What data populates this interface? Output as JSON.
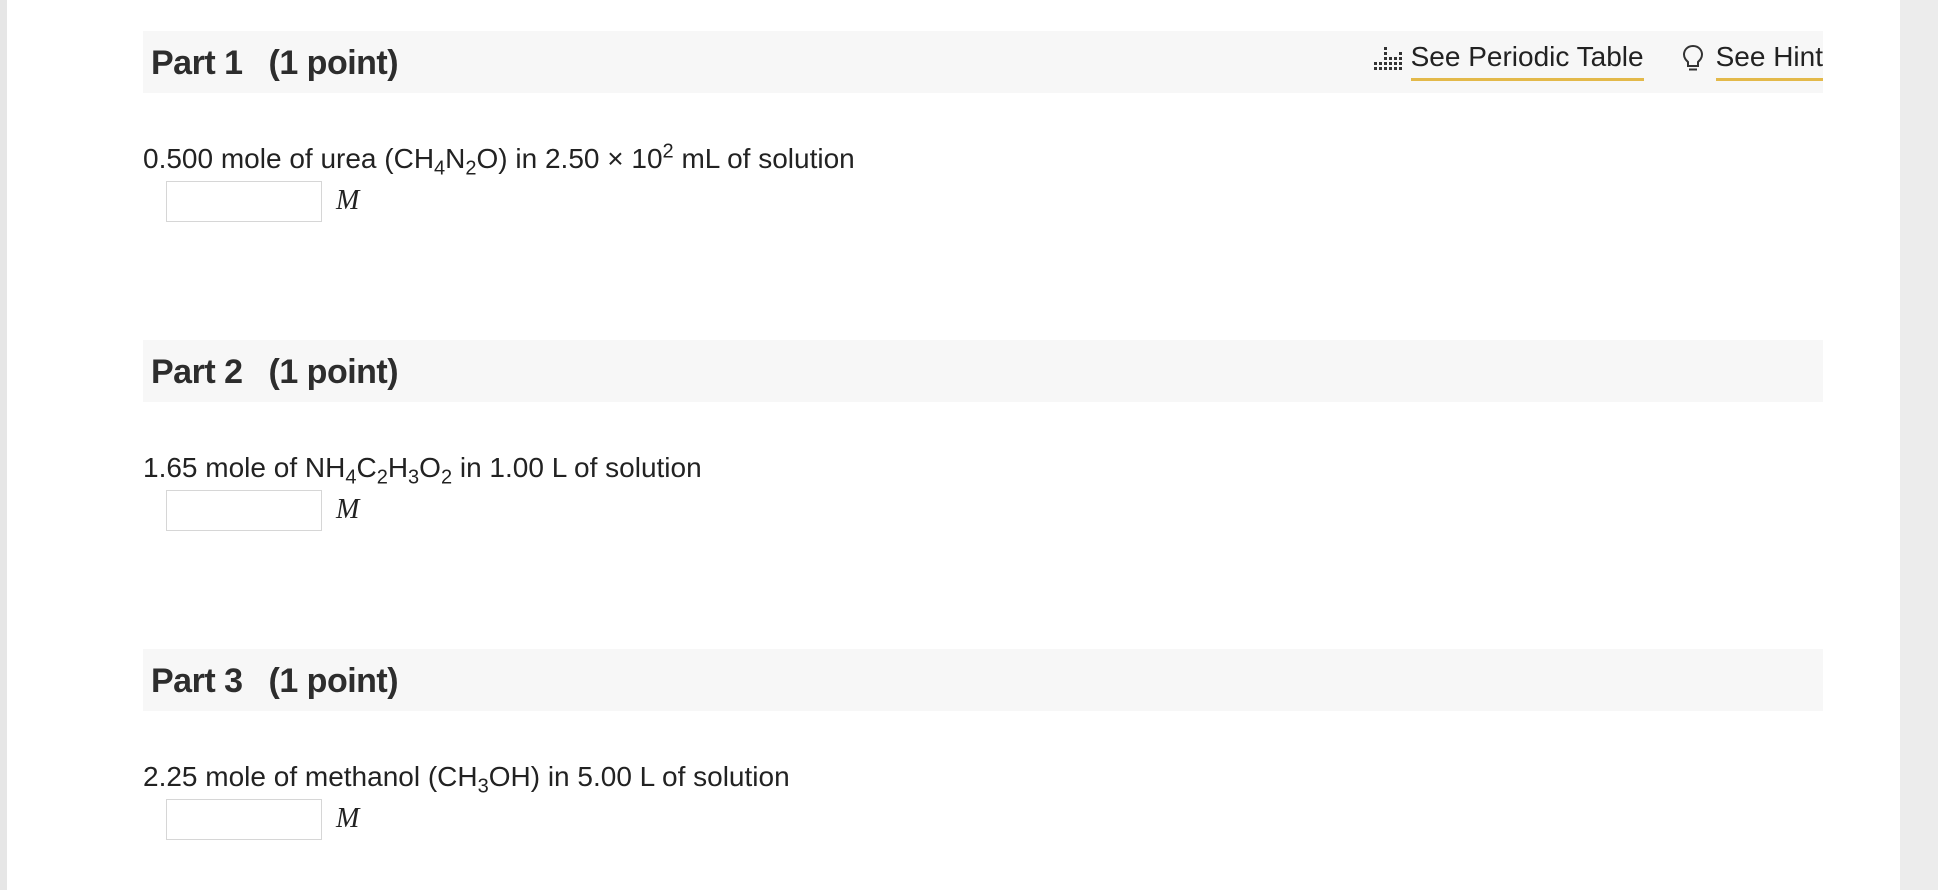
{
  "tools": {
    "periodic_label": "See Periodic Table",
    "hint_label": "See Hint",
    "underline_color": "#e3b94a"
  },
  "parts": [
    {
      "label": "Part 1",
      "points": "(1 point)",
      "question": {
        "lead": "0.500 mole of urea (CH",
        "sub1": "4",
        "mid1": "N",
        "sub2": "2",
        "mid2": "O) in 2.50 × 10",
        "sup": "2",
        "tail": " mL of solution"
      },
      "answer": {
        "value": "",
        "unit": "M"
      }
    },
    {
      "label": "Part 2",
      "points": "(1 point)",
      "question": {
        "lead": "1.65 mole of NH",
        "sub1": "4",
        "mid1": "C",
        "sub2": "2",
        "mid2": "H",
        "sub3": "3",
        "mid3": "O",
        "sub4": "2",
        "tail": " in 1.00 L of solution"
      },
      "answer": {
        "value": "",
        "unit": "M"
      }
    },
    {
      "label": "Part 3",
      "points": "(1 point)",
      "question": {
        "lead": "2.25 mole of methanol (CH",
        "sub1": "3",
        "tail": "OH) in 5.00 L of solution"
      },
      "answer": {
        "value": "",
        "unit": "M"
      }
    }
  ]
}
